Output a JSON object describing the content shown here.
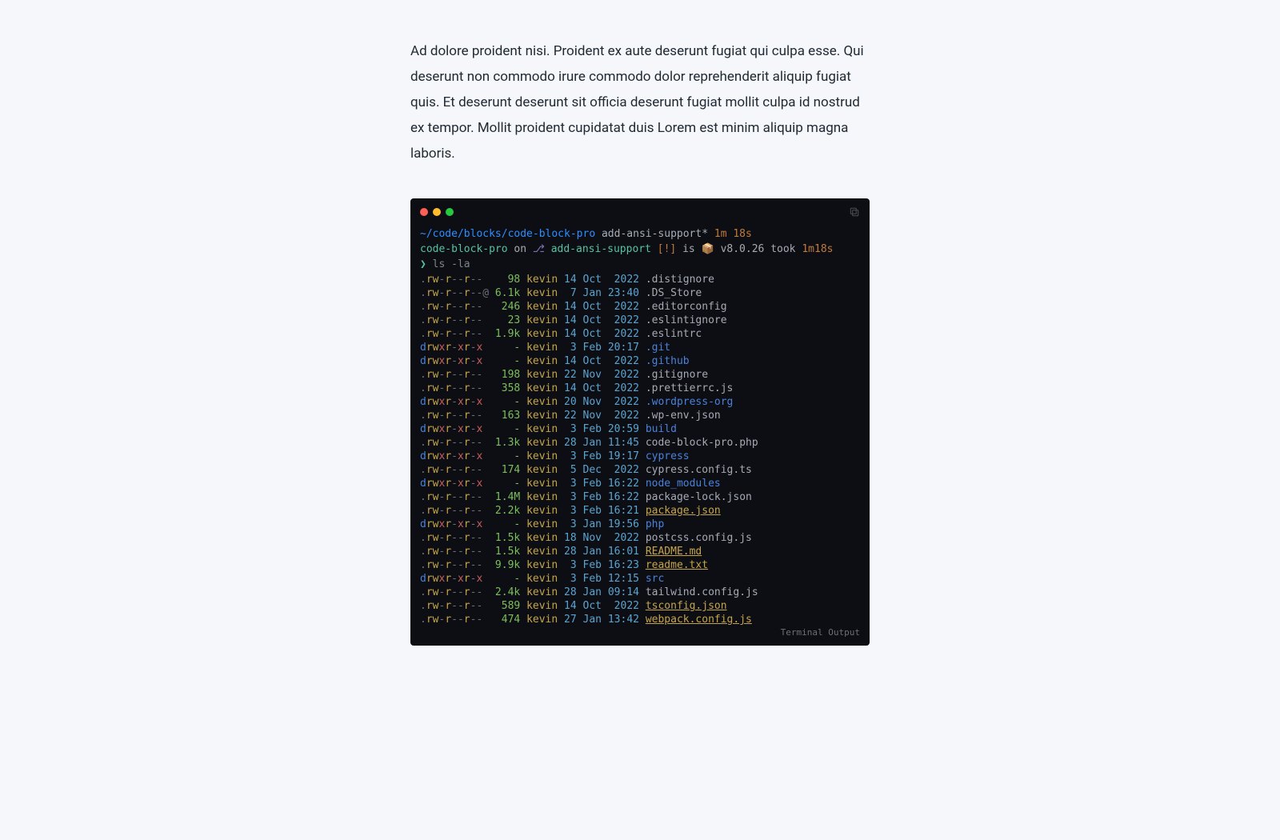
{
  "paragraph": "Ad dolore proident nisi. Proident ex aute deserunt fugiat qui culpa esse. Qui deserunt non commodo irure commodo dolor reprehenderit aliquip fugiat quis. Et deserunt deserunt sit officia deserunt fugiat mollit culpa id nostrud ex tempor. Mollit proident cupidatat duis Lorem est minim aliquip magna laboris.",
  "terminal": {
    "prompt1": {
      "path": "~/code/blocks/code-block-pro",
      "branch": "add-ansi-support*",
      "duration": "1m 18s"
    },
    "prompt2": {
      "repo": "code-block-pro",
      "on": "on",
      "glyph": "⎇",
      "branch": "add-ansi-support",
      "bang": "[!]",
      "is": "is",
      "pkg": "📦",
      "version": "v8.0.26",
      "took": "took",
      "duration": "1m18s"
    },
    "cmd_arrow": "❯",
    "cmd": "ls -la",
    "footer": "Terminal Output",
    "rows": [
      {
        "perm": ".rw-r--r--",
        "size": "98",
        "owner": "kevin",
        "d": "14",
        "m": "Oct",
        "yt": " 2022",
        "name": ".distignore",
        "cls": ""
      },
      {
        "perm": ".rw-r--r--@",
        "size": "6.1k",
        "owner": "kevin",
        "d": "7",
        "m": "Jan",
        "yt": "23:40",
        "name": ".DS_Store",
        "cls": ""
      },
      {
        "perm": ".rw-r--r--",
        "size": "246",
        "owner": "kevin",
        "d": "14",
        "m": "Oct",
        "yt": " 2022",
        "name": ".editorconfig",
        "cls": ""
      },
      {
        "perm": ".rw-r--r--",
        "size": "23",
        "owner": "kevin",
        "d": "14",
        "m": "Oct",
        "yt": " 2022",
        "name": ".eslintignore",
        "cls": ""
      },
      {
        "perm": ".rw-r--r--",
        "size": "1.9k",
        "owner": "kevin",
        "d": "14",
        "m": "Oct",
        "yt": " 2022",
        "name": ".eslintrc",
        "cls": ""
      },
      {
        "perm": "drwxr-xr-x",
        "size": "-",
        "owner": "kevin",
        "d": "3",
        "m": "Feb",
        "yt": "20:17",
        "name": ".git",
        "cls": "dir"
      },
      {
        "perm": "drwxr-xr-x",
        "size": "-",
        "owner": "kevin",
        "d": "14",
        "m": "Oct",
        "yt": " 2022",
        "name": ".github",
        "cls": "dir"
      },
      {
        "perm": ".rw-r--r--",
        "size": "198",
        "owner": "kevin",
        "d": "22",
        "m": "Nov",
        "yt": " 2022",
        "name": ".gitignore",
        "cls": ""
      },
      {
        "perm": ".rw-r--r--",
        "size": "358",
        "owner": "kevin",
        "d": "14",
        "m": "Oct",
        "yt": " 2022",
        "name": ".prettierrc.js",
        "cls": ""
      },
      {
        "perm": "drwxr-xr-x",
        "size": "-",
        "owner": "kevin",
        "d": "20",
        "m": "Nov",
        "yt": " 2022",
        "name": ".wordpress-org",
        "cls": "dir"
      },
      {
        "perm": ".rw-r--r--",
        "size": "163",
        "owner": "kevin",
        "d": "22",
        "m": "Nov",
        "yt": " 2022",
        "name": ".wp-env.json",
        "cls": ""
      },
      {
        "perm": "drwxr-xr-x",
        "size": "-",
        "owner": "kevin",
        "d": "3",
        "m": "Feb",
        "yt": "20:59",
        "name": "build",
        "cls": "dir"
      },
      {
        "perm": ".rw-r--r--",
        "size": "1.3k",
        "owner": "kevin",
        "d": "28",
        "m": "Jan",
        "yt": "11:45",
        "name": "code-block-pro.php",
        "cls": ""
      },
      {
        "perm": "drwxr-xr-x",
        "size": "-",
        "owner": "kevin",
        "d": "3",
        "m": "Feb",
        "yt": "19:17",
        "name": "cypress",
        "cls": "dir"
      },
      {
        "perm": ".rw-r--r--",
        "size": "174",
        "owner": "kevin",
        "d": "5",
        "m": "Dec",
        "yt": " 2022",
        "name": "cypress.config.ts",
        "cls": ""
      },
      {
        "perm": "drwxr-xr-x",
        "size": "-",
        "owner": "kevin",
        "d": "3",
        "m": "Feb",
        "yt": "16:22",
        "name": "node_modules",
        "cls": "dir"
      },
      {
        "perm": ".rw-r--r--",
        "size": "1.4M",
        "owner": "kevin",
        "d": "3",
        "m": "Feb",
        "yt": "16:22",
        "name": "package-lock.json",
        "cls": ""
      },
      {
        "perm": ".rw-r--r--",
        "size": "2.2k",
        "owner": "kevin",
        "d": "3",
        "m": "Feb",
        "yt": "16:21",
        "name": "package.json",
        "cls": "exec"
      },
      {
        "perm": "drwxr-xr-x",
        "size": "-",
        "owner": "kevin",
        "d": "3",
        "m": "Jan",
        "yt": "19:56",
        "name": "php",
        "cls": "dir"
      },
      {
        "perm": ".rw-r--r--",
        "size": "1.5k",
        "owner": "kevin",
        "d": "18",
        "m": "Nov",
        "yt": " 2022",
        "name": "postcss.config.js",
        "cls": ""
      },
      {
        "perm": ".rw-r--r--",
        "size": "1.5k",
        "owner": "kevin",
        "d": "28",
        "m": "Jan",
        "yt": "16:01",
        "name": "README.md",
        "cls": "exec"
      },
      {
        "perm": ".rw-r--r--",
        "size": "9.9k",
        "owner": "kevin",
        "d": "3",
        "m": "Feb",
        "yt": "16:23",
        "name": "readme.txt",
        "cls": "exec"
      },
      {
        "perm": "drwxr-xr-x",
        "size": "-",
        "owner": "kevin",
        "d": "3",
        "m": "Feb",
        "yt": "12:15",
        "name": "src",
        "cls": "dir"
      },
      {
        "perm": ".rw-r--r--",
        "size": "2.4k",
        "owner": "kevin",
        "d": "28",
        "m": "Jan",
        "yt": "09:14",
        "name": "tailwind.config.js",
        "cls": ""
      },
      {
        "perm": ".rw-r--r--",
        "size": "589",
        "owner": "kevin",
        "d": "14",
        "m": "Oct",
        "yt": " 2022",
        "name": "tsconfig.json",
        "cls": "exec"
      },
      {
        "perm": ".rw-r--r--",
        "size": "474",
        "owner": "kevin",
        "d": "27",
        "m": "Jan",
        "yt": "13:42",
        "name": "webpack.config.js",
        "cls": "exec"
      }
    ]
  }
}
